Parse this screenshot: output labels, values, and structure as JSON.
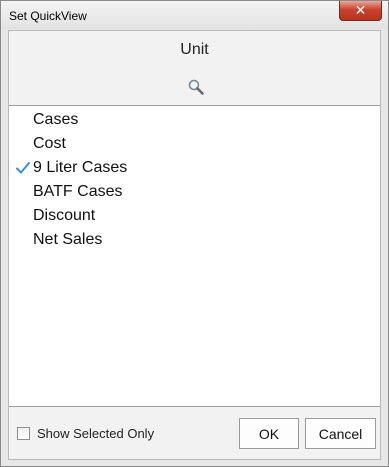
{
  "window": {
    "title": "Set QuickView",
    "close_glyph": "✕"
  },
  "header": {
    "title": "Unit"
  },
  "search": {
    "icon": "magnifier-icon"
  },
  "list": {
    "items": [
      {
        "label": "Cases",
        "checked": false
      },
      {
        "label": "Cost",
        "checked": false
      },
      {
        "label": "9 Liter Cases",
        "checked": true
      },
      {
        "label": "BATF Cases",
        "checked": false
      },
      {
        "label": "Discount",
        "checked": false
      },
      {
        "label": "Net Sales",
        "checked": false
      }
    ],
    "check_color": "#3a8fd8"
  },
  "footer": {
    "show_selected_label": "Show Selected Only",
    "show_selected_checked": false,
    "ok_label": "OK",
    "cancel_label": "Cancel"
  }
}
